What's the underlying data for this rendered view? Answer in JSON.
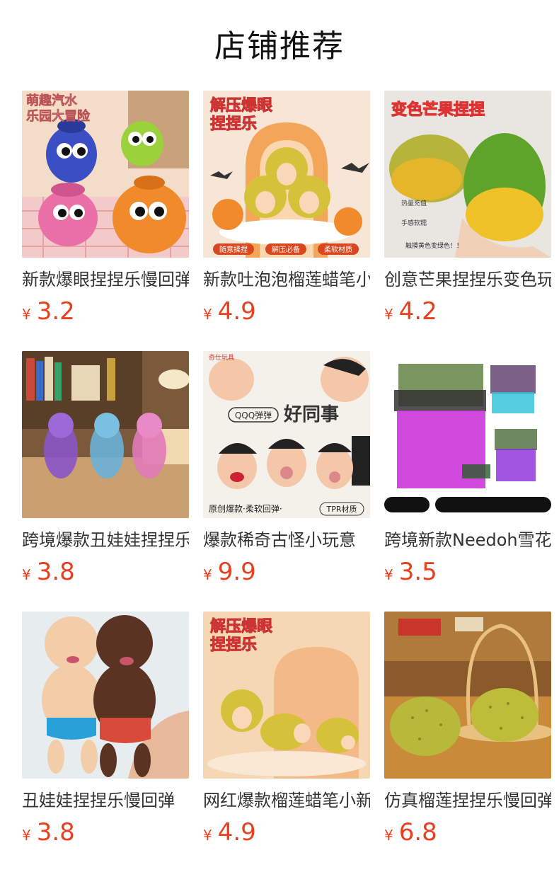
{
  "header": {
    "title": "店铺推荐"
  },
  "products": [
    {
      "name": "新款爆眼捏捏乐慢回弹",
      "currency": "¥",
      "price": "3.2",
      "image_text": [
        "萌趣汽水",
        "乐园大冒险"
      ]
    },
    {
      "name": "新款吐泡泡榴莲蜡笔小新",
      "currency": "¥",
      "price": "4.9",
      "image_text": [
        "解压爆眼",
        "捏捏乐",
        "随意揉捏",
        "解压必备",
        "柔软材质"
      ]
    },
    {
      "name": "创意芒果捏捏乐变色玩具",
      "currency": "¥",
      "price": "4.2",
      "image_text": [
        "变色芒果捏捏",
        "热量充值",
        "手感软糯",
        "触摸黄色变绿色！！"
      ]
    },
    {
      "name": "跨境爆款丑娃娃捏捏乐",
      "currency": "¥",
      "price": "3.8",
      "image_text": []
    },
    {
      "name": "爆款稀奇古怪小玩意",
      "currency": "¥",
      "price": "9.9",
      "image_text": [
        "奇仕玩具",
        "QQQ弹弹",
        "好同事",
        "原创爆款·柔软回弹·",
        "TPR材质"
      ]
    },
    {
      "name": "跨境新款Needoh雪花",
      "currency": "¥",
      "price": "3.5",
      "image_text": []
    },
    {
      "name": "丑娃娃捏捏乐慢回弹",
      "currency": "¥",
      "price": "3.8",
      "image_text": []
    },
    {
      "name": "网红爆款榴莲蜡笔小新",
      "currency": "¥",
      "price": "4.9",
      "image_text": [
        "解压爆眼",
        "捏捏乐"
      ]
    },
    {
      "name": "仿真榴莲捏捏乐慢回弹",
      "currency": "¥",
      "price": "6.8",
      "image_text": []
    }
  ],
  "colors": {
    "price": "#e8401f",
    "title": "#111111",
    "name": "#333333"
  }
}
